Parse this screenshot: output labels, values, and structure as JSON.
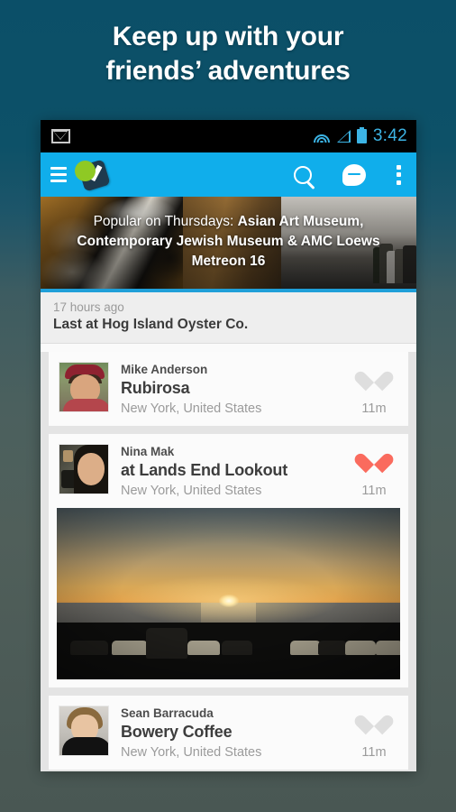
{
  "headline": {
    "line1": "Keep up with your",
    "line2": "friends’ adventures"
  },
  "statusbar": {
    "notification_icon": "gmail-icon",
    "wifi_icon": "wifi-icon",
    "signal_icon": "cell-signal-icon",
    "battery_icon": "battery-icon",
    "time": "3:42"
  },
  "actionbar": {
    "menu_icon": "hamburger-menu-icon",
    "logo_icon": "foursquare-swarm-logo-icon",
    "search_icon": "search-icon",
    "messages_icon": "chat-bubble-icon",
    "overflow_icon": "overflow-menu-icon",
    "background_color": "#10aeeb"
  },
  "banner": {
    "prefix": "Popular on Thursdays:",
    "venues": "Asian Art Museum, Contemporary Jewish Museum & AMC Loews Metreon 16",
    "accent_color": "#1f9fd8"
  },
  "last_checkin": {
    "time_ago": "17 hours ago",
    "label": "Last at Hog Island Oyster Co."
  },
  "feed": {
    "items": [
      {
        "user": "Mike Anderson",
        "venue": "Rubirosa",
        "location": "New York, United States",
        "time": "11m",
        "heart_icon": "heart-icon",
        "liked": false,
        "heart_color": "#dedede",
        "has_photo": false
      },
      {
        "user": "Nina Mak",
        "venue": "at Lands End Lookout",
        "location": "New York, United States",
        "time": "11m",
        "heart_icon": "heart-icon",
        "liked": true,
        "heart_color": "#fa6b5e",
        "has_photo": true,
        "photo_alt": "sunset-over-ocean-photo"
      },
      {
        "user": "Sean Barracuda",
        "venue": "Bowery Coffee",
        "location": "New York, United States",
        "time": "11m",
        "heart_icon": "heart-icon",
        "liked": false,
        "heart_color": "#dedede",
        "has_photo": false
      }
    ]
  }
}
